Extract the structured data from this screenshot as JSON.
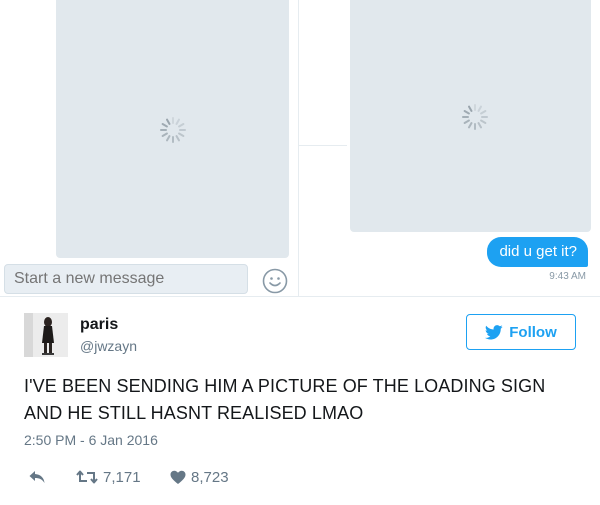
{
  "dm_left": {
    "compose_placeholder": "Start a new message",
    "icons": {
      "loading": "loading-spinner-icon",
      "emoji": "smiley-face-icon"
    }
  },
  "dm_right": {
    "message": "did u get it?",
    "timestamp": "9:43 AM",
    "icons": {
      "loading": "loading-spinner-icon"
    }
  },
  "tweet": {
    "display_name": "paris",
    "handle": "@jwzayn",
    "follow_label": "Follow",
    "text": "I'VE BEEN SENDING HIM A PICTURE OF THE LOADING SIGN AND HE STILL HASNT REALISED LMAO",
    "timestamp": "2:50 PM - 6 Jan 2016",
    "retweets": "7,171",
    "likes": "8,723",
    "icons": {
      "reply": "reply-arrow-icon",
      "retweet": "retweet-icon",
      "like": "heart-icon",
      "follow": "twitter-bird-icon"
    }
  },
  "colors": {
    "accent": "#1da1f2",
    "placeholder_image": "#e1e8ed",
    "secondary_text": "#657786"
  }
}
